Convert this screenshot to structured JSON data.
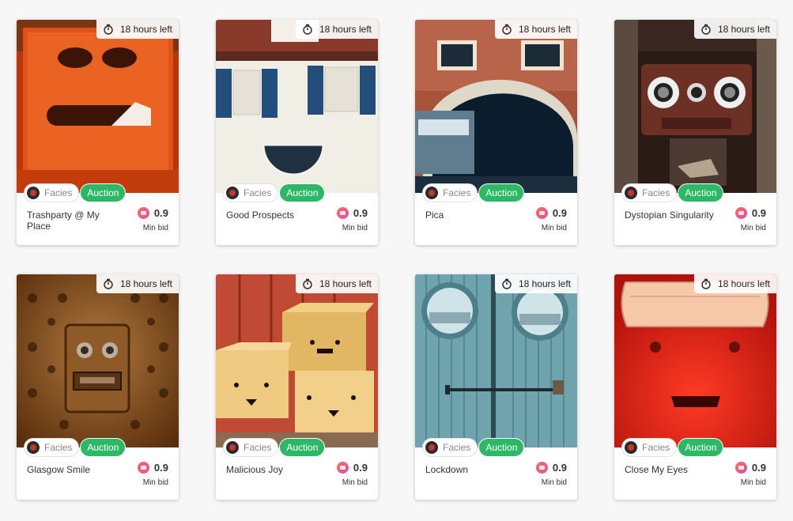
{
  "cards": [
    {
      "title": "Trashparty @ My Place",
      "timer": "18 hours left",
      "collection": "Facies",
      "badge": "Auction",
      "price": "0.9",
      "price_label": "Min bid",
      "image": "orange-trash-bin-face",
      "colors": {
        "bg": "#d2450d",
        "accent": "#f07a2a"
      }
    },
    {
      "title": "Good Prospects",
      "timer": "18 hours left",
      "collection": "Facies",
      "badge": "Auction",
      "price": "0.9",
      "price_label": "Min bid",
      "image": "white-house-face",
      "colors": {
        "bg": "#f2efe8",
        "accent": "#2a5a86"
      }
    },
    {
      "title": "Pica",
      "timer": "18 hours left",
      "collection": "Facies",
      "badge": "Auction",
      "price": "0.9",
      "price_label": "Min bid",
      "image": "canal-bridge-face",
      "colors": {
        "bg": "#b65a3c",
        "accent": "#0c2233"
      }
    },
    {
      "title": "Dystopian Singularity",
      "timer": "18 hours left",
      "collection": "Facies",
      "badge": "Auction",
      "price": "0.9",
      "price_label": "Min bid",
      "image": "meter-box-face",
      "colors": {
        "bg": "#3b2620",
        "accent": "#6a2f25"
      }
    },
    {
      "title": "Glasgow Smile",
      "timer": "18 hours left",
      "collection": "Facies",
      "badge": "Auction",
      "price": "0.9",
      "price_label": "Min bid",
      "image": "metal-panel-face",
      "colors": {
        "bg": "#7a4a1a",
        "accent": "#b07a3a"
      }
    },
    {
      "title": "Malicious Joy",
      "timer": "18 hours left",
      "collection": "Facies",
      "badge": "Auction",
      "price": "0.9",
      "price_label": "Min bid",
      "image": "cardboard-boxes-face",
      "colors": {
        "bg": "#c8523c",
        "accent": "#e9c27a"
      }
    },
    {
      "title": "Lockdown",
      "timer": "18 hours left",
      "collection": "Facies",
      "badge": "Auction",
      "price": "0.9",
      "price_label": "Min bid",
      "image": "blue-door-face",
      "colors": {
        "bg": "#6fa4b0",
        "accent": "#b9d8dd"
      }
    },
    {
      "title": "Close My Eyes",
      "timer": "18 hours left",
      "collection": "Facies",
      "badge": "Auction",
      "price": "0.9",
      "price_label": "Min bid",
      "image": "red-car-face",
      "colors": {
        "bg": "#e0281c",
        "accent": "#f9c8a8"
      }
    }
  ],
  "icons": {
    "timer": "stopwatch-icon",
    "coin": "ws-coin-icon",
    "avatar": "collection-avatar"
  }
}
